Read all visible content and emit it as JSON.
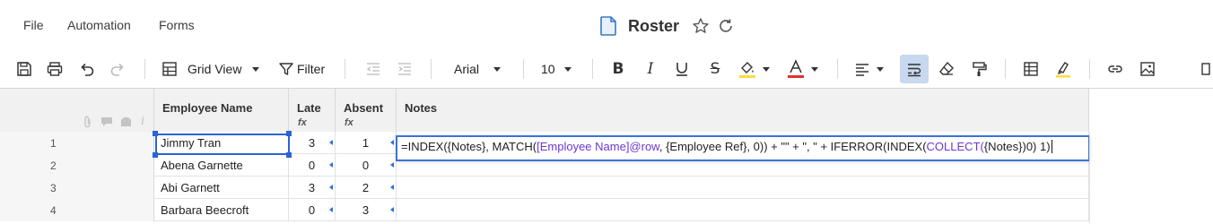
{
  "menu": {
    "file": "File",
    "automation": "Automation",
    "forms": "Forms"
  },
  "sheet": {
    "title": "Roster",
    "icon": "sheet-icon"
  },
  "colors": {
    "accent": "#2b62d9",
    "formula_ref": "#6d37d2",
    "highlight_yellow": "#f6df3b",
    "text_red": "#e0322b"
  },
  "toolbar": {
    "view_label": "Grid View",
    "filter_label": "Filter",
    "font_family": "Arial",
    "font_size": "10",
    "icons": [
      "save-icon",
      "print-icon",
      "undo-icon",
      "redo-icon",
      "grid-view-icon",
      "filter-icon",
      "outdent-icon",
      "indent-icon",
      "bold-icon",
      "italic-icon",
      "underline-icon",
      "strikethrough-icon",
      "fill-color-icon",
      "text-color-icon",
      "align-left-icon",
      "wrap-text-icon",
      "clear-format-icon",
      "format-painter-icon",
      "table-icon",
      "highlight-icon",
      "link-icon",
      "image-icon",
      "more-icon"
    ]
  },
  "columns": [
    {
      "title": "Employee Name",
      "formula": false
    },
    {
      "title": "Late",
      "formula": true
    },
    {
      "title": "Absent",
      "formula": true
    },
    {
      "title": "Notes",
      "formula": false
    }
  ],
  "fx_symbol": "fx",
  "rows": [
    {
      "num": "1",
      "name": "Jimmy Tran",
      "late": "3",
      "absent": "1"
    },
    {
      "num": "2",
      "name": "Abena Garnette",
      "late": "0",
      "absent": "0"
    },
    {
      "num": "3",
      "name": "Abi Garnett",
      "late": "3",
      "absent": "2"
    },
    {
      "num": "4",
      "name": "Barbara Beecroft",
      "late": "0",
      "absent": "3"
    }
  ],
  "formula": {
    "p1": "=INDEX({Notes}, MATCH(",
    "p2": "[Employee Name]@row",
    "p3": ", {Employee Ref}, 0)) + \"\" + \", \" + IFERROR(INDEX(",
    "p4": "COLLECT(",
    "p5": "{Notes}",
    "p6": ")0) 1)"
  }
}
